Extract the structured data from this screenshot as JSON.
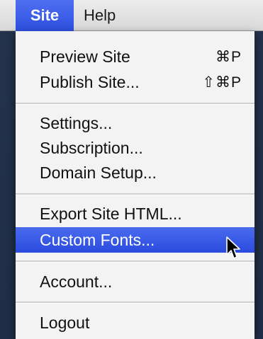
{
  "menubar": {
    "site_label": "Site",
    "help_label": "Help"
  },
  "site_menu": {
    "preview_site": {
      "label": "Preview Site",
      "shortcut": "⌘P"
    },
    "publish_site": {
      "label": "Publish Site...",
      "shortcut": "⇧⌘P"
    },
    "settings": {
      "label": "Settings..."
    },
    "subscription": {
      "label": "Subscription..."
    },
    "domain_setup": {
      "label": "Domain Setup..."
    },
    "export_html": {
      "label": "Export Site HTML..."
    },
    "custom_fonts": {
      "label": "Custom Fonts..."
    },
    "account": {
      "label": "Account..."
    },
    "logout": {
      "label": "Logout"
    }
  },
  "colors": {
    "highlight": "#2d4fe0",
    "menu_background": "#f3f3f3",
    "desktop": "#24344c"
  },
  "icons": {
    "cursor": "arrow-cursor-icon"
  }
}
